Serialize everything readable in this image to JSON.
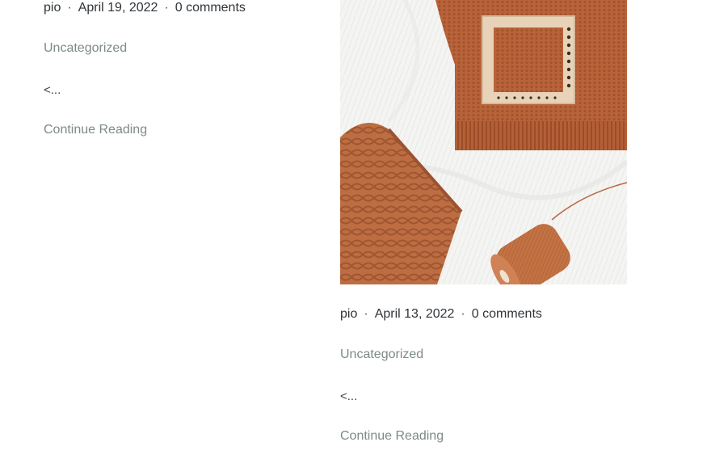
{
  "posts": [
    {
      "author": "pio",
      "date": "April 19, 2022",
      "comments": "0 comments",
      "separator": "·",
      "category": "Uncategorized",
      "excerpt": "<...",
      "read_more": "Continue Reading"
    },
    {
      "author": "pio",
      "date": "April 13, 2022",
      "comments": "0 comments",
      "separator": "·",
      "category": "Uncategorized",
      "excerpt": "<...",
      "read_more": "Continue Reading",
      "image": "knitting-thumbnail"
    }
  ],
  "colors": {
    "text": "#2f3438",
    "link_muted": "#7c8b86",
    "knit": "#b9653a",
    "fabric": "#f1f1ef"
  }
}
